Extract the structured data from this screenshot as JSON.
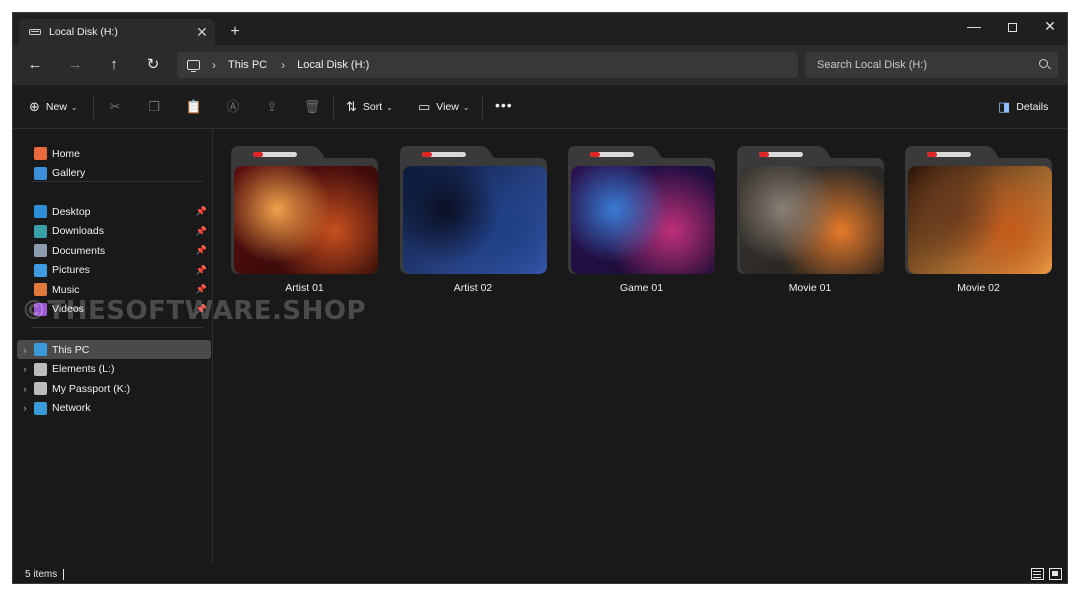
{
  "window": {
    "tab_title": "Local Disk (H:)",
    "tab_close": "✕",
    "new_tab": "+",
    "minimize": "—",
    "close": "✕"
  },
  "nav": {
    "back": "←",
    "forward": "→",
    "up": "↑",
    "refresh": "↻",
    "chevron": "›",
    "breadcrumb": [
      "This PC",
      "Local Disk (H:)"
    ],
    "search_placeholder": "Search Local Disk (H:)"
  },
  "toolbar": {
    "new_label": "New",
    "sort_label": "Sort",
    "view_label": "View",
    "more": "•••",
    "details_label": "Details",
    "caret": "⌄"
  },
  "sidebar": {
    "quick": [
      {
        "label": "Home",
        "icon": "home-icon",
        "color": "#e86a3a"
      },
      {
        "label": "Gallery",
        "icon": "gallery-icon",
        "color": "#3b8fd9"
      }
    ],
    "pinned": [
      {
        "label": "Desktop",
        "icon": "desktop-icon",
        "color": "#2f8fd6"
      },
      {
        "label": "Downloads",
        "icon": "downloads-icon",
        "color": "#3aa0a8"
      },
      {
        "label": "Documents",
        "icon": "documents-icon",
        "color": "#8c9bb0"
      },
      {
        "label": "Pictures",
        "icon": "pictures-icon",
        "color": "#3f9be0"
      },
      {
        "label": "Music",
        "icon": "music-icon",
        "color": "#e0793a"
      },
      {
        "label": "Videos",
        "icon": "videos-icon",
        "color": "#9b59d0"
      }
    ],
    "pin_glyph": "📌",
    "expander": "›",
    "drives": [
      {
        "label": "This PC",
        "icon": "this-pc-icon",
        "color": "#3a9ad9",
        "selected": true
      },
      {
        "label": "Elements (L:)",
        "icon": "drive-icon",
        "color": "#bcbcbc",
        "selected": false
      },
      {
        "label": "My Passport (K:)",
        "icon": "drive-icon",
        "color": "#bcbcbc",
        "selected": false
      },
      {
        "label": "Network",
        "icon": "network-icon",
        "color": "#3a9ad9",
        "selected": false
      }
    ]
  },
  "folders": [
    {
      "label": "Artist 01",
      "palette": [
        "#5a0f0f",
        "#c8501e",
        "#f1a14a",
        "#2a0808"
      ]
    },
    {
      "label": "Artist 02",
      "palette": [
        "#0b1a3d",
        "#1d3f86",
        "#0a0f22",
        "#3a5bb0"
      ]
    },
    {
      "label": "Game 01",
      "palette": [
        "#2a1250",
        "#c0307a",
        "#3a7bd5",
        "#150a30"
      ]
    },
    {
      "label": "Movie 01",
      "palette": [
        "#3b3631",
        "#e57a2a",
        "#8a8075",
        "#1f1d1b"
      ]
    },
    {
      "label": "Movie 02",
      "palette": [
        "#2b1408",
        "#c45a1a",
        "#6a3a1e",
        "#f2a24a"
      ]
    }
  ],
  "watermark": "©THESOFTWARE.SHOP",
  "status": {
    "items_count": "5 items"
  }
}
